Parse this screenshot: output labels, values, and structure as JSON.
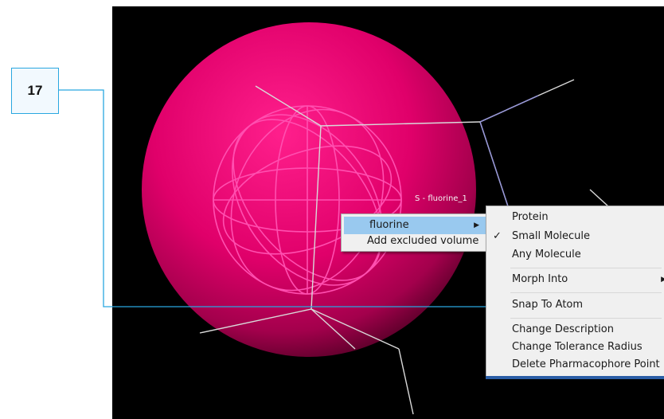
{
  "callout": {
    "number": "17",
    "color": "#29a7e0"
  },
  "scene": {
    "atom_label": "S - fluorine_1",
    "sphere_color": "#e0006a",
    "wire_color": "#ff4fb0",
    "background": "#000000"
  },
  "context_menu": {
    "items": [
      {
        "label": "fluorine",
        "has_submenu": true,
        "highlighted": true
      },
      {
        "label": "Add excluded volume",
        "has_submenu": false
      }
    ]
  },
  "submenu": {
    "items": [
      {
        "label": "Protein",
        "checked": false
      },
      {
        "label": "Small Molecule",
        "checked": true
      },
      {
        "label": "Any Molecule",
        "checked": false
      },
      {
        "label": "Morph Into",
        "has_submenu": true
      },
      {
        "label": "Snap To Atom"
      },
      {
        "label": "Change Description"
      },
      {
        "label": "Change Tolerance Radius"
      },
      {
        "label": "Delete Pharmacophore Point"
      }
    ]
  }
}
